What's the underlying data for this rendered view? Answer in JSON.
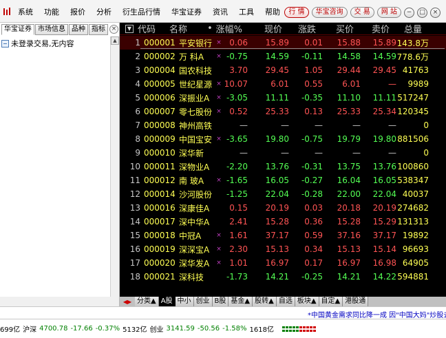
{
  "menu": {
    "items": [
      "系统",
      "功能",
      "报价",
      "分析",
      "衍生品行情",
      "华宝证券",
      "资讯",
      "工具",
      "帮助"
    ],
    "right_buttons": [
      "行 情",
      "华宝咨询",
      "交 易",
      "网 站"
    ],
    "active_button_index": 0,
    "window_buttons": [
      "−",
      "□",
      "×"
    ]
  },
  "left_panel": {
    "tabs": [
      "华宝证券",
      "市场信息",
      "品种",
      "指标"
    ],
    "close_glyph": "×",
    "tree_item": "未登录交易,无内容"
  },
  "quote_table": {
    "headers": {
      "sort": "▼",
      "code": "代码",
      "name": "名称",
      "dot": "•",
      "change_pct": "涨幅%",
      "price": "现价",
      "change": "涨跌",
      "bid": "买价",
      "ask": "卖价",
      "volume": "总量"
    },
    "rows": [
      {
        "idx": "1",
        "code": "000001",
        "name": "平安银行",
        "dot": "×",
        "pct": "0.06",
        "price": "15.89",
        "chg": "0.01",
        "bid": "15.88",
        "ask": "15.89",
        "vol": "143.8万",
        "pc": "red",
        "selected": true
      },
      {
        "idx": "2",
        "code": "000002",
        "name": "万 科A",
        "dot": "×",
        "pct": "-0.75",
        "price": "14.59",
        "chg": "-0.11",
        "bid": "14.58",
        "ask": "14.59",
        "vol": "778.6万",
        "pc": "green"
      },
      {
        "idx": "3",
        "code": "000004",
        "name": "国农科技",
        "dot": "",
        "pct": "3.70",
        "price": "29.45",
        "chg": "1.05",
        "bid": "29.44",
        "ask": "29.45",
        "vol": "41763",
        "pc": "red"
      },
      {
        "idx": "4",
        "code": "000005",
        "name": "世纪星源",
        "dot": "×",
        "pct": "10.07",
        "price": "6.01",
        "chg": "0.55",
        "bid": "6.01",
        "ask": "—",
        "vol": "9989",
        "pc": "red"
      },
      {
        "idx": "5",
        "code": "000006",
        "name": "深振业A",
        "dot": "×",
        "pct": "-3.05",
        "price": "11.11",
        "chg": "-0.35",
        "bid": "11.10",
        "ask": "11.11",
        "vol": "517247",
        "pc": "green"
      },
      {
        "idx": "6",
        "code": "000007",
        "name": "零七股份",
        "dot": "×",
        "pct": "0.52",
        "price": "25.33",
        "chg": "0.13",
        "bid": "25.33",
        "ask": "25.34",
        "vol": "120345",
        "pc": "red"
      },
      {
        "idx": "7",
        "code": "000008",
        "name": "神州高铁",
        "dot": "",
        "pct": "—",
        "price": "—",
        "chg": "—",
        "bid": "—",
        "ask": "—",
        "vol": "0",
        "pc": "gray"
      },
      {
        "idx": "8",
        "code": "000009",
        "name": "中国宝安",
        "dot": "×",
        "pct": "-3.65",
        "price": "19.80",
        "chg": "-0.75",
        "bid": "19.79",
        "ask": "19.80",
        "vol": "881506",
        "pc": "green"
      },
      {
        "idx": "9",
        "code": "000010",
        "name": "深华新",
        "dot": "",
        "pct": "—",
        "price": "—",
        "chg": "—",
        "bid": "—",
        "ask": "—",
        "vol": "0",
        "pc": "gray"
      },
      {
        "idx": "10",
        "code": "000011",
        "name": "深物业A",
        "dot": "",
        "pct": "-2.20",
        "price": "13.76",
        "chg": "-0.31",
        "bid": "13.75",
        "ask": "13.76",
        "vol": "100860",
        "pc": "green"
      },
      {
        "idx": "11",
        "code": "000012",
        "name": "南 玻A",
        "dot": "×",
        "pct": "-1.65",
        "price": "16.05",
        "chg": "-0.27",
        "bid": "16.04",
        "ask": "16.05",
        "vol": "538347",
        "pc": "green"
      },
      {
        "idx": "12",
        "code": "000014",
        "name": "沙河股份",
        "dot": "",
        "pct": "-1.25",
        "price": "22.04",
        "chg": "-0.28",
        "bid": "22.00",
        "ask": "22.04",
        "vol": "40037",
        "pc": "green"
      },
      {
        "idx": "13",
        "code": "000016",
        "name": "深康佳A",
        "dot": "",
        "pct": "0.15",
        "price": "20.19",
        "chg": "0.03",
        "bid": "20.18",
        "ask": "20.19",
        "vol": "274682",
        "pc": "red"
      },
      {
        "idx": "14",
        "code": "000017",
        "name": "深中华A",
        "dot": "",
        "pct": "2.41",
        "price": "15.28",
        "chg": "0.36",
        "bid": "15.28",
        "ask": "15.29",
        "vol": "131313",
        "pc": "red"
      },
      {
        "idx": "15",
        "code": "000018",
        "name": "中冠A",
        "dot": "×",
        "pct": "1.61",
        "price": "37.17",
        "chg": "0.59",
        "bid": "37.16",
        "ask": "37.17",
        "vol": "19892",
        "pc": "red"
      },
      {
        "idx": "16",
        "code": "000019",
        "name": "深深宝A",
        "dot": "×",
        "pct": "2.30",
        "price": "15.13",
        "chg": "0.34",
        "bid": "15.13",
        "ask": "15.14",
        "vol": "96693",
        "pc": "red"
      },
      {
        "idx": "17",
        "code": "000020",
        "name": "深华发A",
        "dot": "×",
        "pct": "1.01",
        "price": "16.97",
        "chg": "0.17",
        "bid": "16.97",
        "ask": "16.98",
        "vol": "64905",
        "pc": "red"
      },
      {
        "idx": "18",
        "code": "000021",
        "name": "深科技",
        "dot": "",
        "pct": "-1.73",
        "price": "14.21",
        "chg": "-0.25",
        "bid": "14.21",
        "ask": "14.22",
        "vol": "594881",
        "pc": "green"
      }
    ]
  },
  "bottom_tabs": {
    "nav": "◀▶",
    "items": [
      "分类▲",
      "A股",
      "中小",
      "创业",
      "B股",
      "基金▲",
      "股转▲",
      "自选",
      "板块▲",
      "自定▲",
      "港股通"
    ],
    "active_index": 1
  },
  "ticker": {
    "text": "*中国黄金需求同比降一成 因\"中国大妈\"炒股去"
  },
  "status": {
    "left_cut": "699亿",
    "sh_label": "沪深",
    "sh_value": "4700.78",
    "sh_change": "-17.66",
    "sh_pct": "-0.37%",
    "sh_amount": "5132亿",
    "cy_label": "创业",
    "cy_value": "3141.59",
    "cy_change": "-50.56",
    "cy_pct": "-1.58%",
    "cy_amount": "1618亿"
  },
  "colors": {
    "up": "#ff5454",
    "down": "#54ff54",
    "code": "#ffff54",
    "bg": "#000000",
    "brand": "#c00000",
    "ticker": "#0000c0"
  }
}
